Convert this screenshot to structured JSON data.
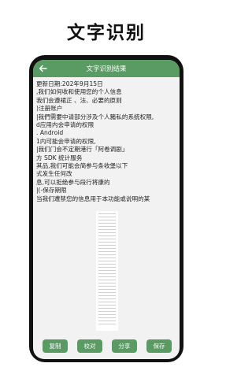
{
  "page": {
    "title": "文字识别"
  },
  "appbar": {
    "title": "文字识别结果"
  },
  "ocr_lines": [
    "更新日期:202年9月15日",
    ",我们如何收和使用您的个人信息",
    "我们会遵裙正 、法、必要的原则",
    ")注册账户",
    "|我們需要中请部分涉及个人豬私的系统权限,",
    "d应用内会申请的权限",
    ". Android",
    "1内可能会申请的权限,",
    "|我们门会不定期港行「阿卷调剧」",
    "方 SDK 统计服务",
    "其品,我们可能会简参与条收堡以下",
    "式发生任何改",
    "息,可以拒绝参与段行将康的",
    "|(-保存期限",
    "当我们遭禁您的信息用于本功能或说明的某"
  ],
  "buttons": {
    "copy": "复制",
    "proofread": "校对",
    "share": "分享",
    "save": "保存"
  },
  "colors": {
    "accent": "#5a9a63",
    "frame": "#111111",
    "screen": "#f2f2f2"
  }
}
